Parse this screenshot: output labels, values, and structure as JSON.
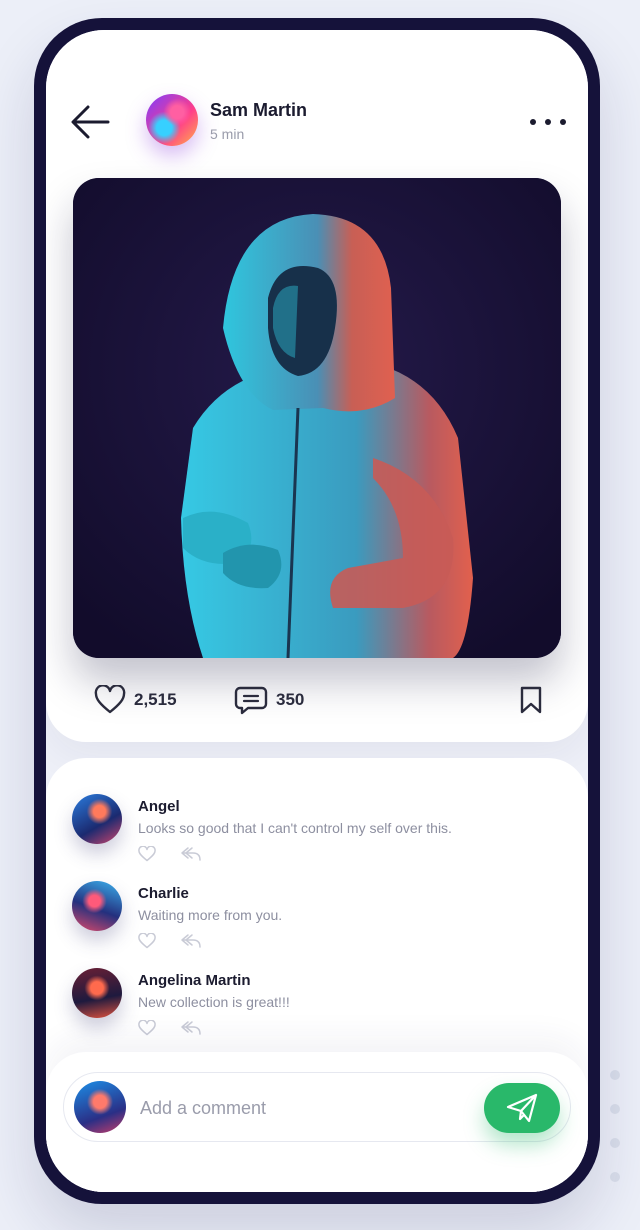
{
  "post": {
    "author": "Sam Martin",
    "time": "5 min",
    "likes": "2,515",
    "comments_count": "350"
  },
  "comments": [
    {
      "name": "Angel",
      "text": "Looks so good that I can't control my self over this."
    },
    {
      "name": "Charlie",
      "text": "Waiting more from you."
    },
    {
      "name": "Angelina Martin",
      "text": "New collection is great!!!"
    }
  ],
  "composer": {
    "placeholder": "Add a comment"
  },
  "colors": {
    "frame": "#15123a",
    "send_button": "#29b86a",
    "text_primary": "#1b1b2f",
    "text_secondary": "#8d8fa0"
  },
  "icons": {
    "back": "arrow-left-icon",
    "more": "more-horizontal-icon",
    "like": "heart-icon",
    "comment": "chat-bubble-icon",
    "bookmark": "bookmark-icon",
    "reply": "reply-icon",
    "send": "paper-plane-icon"
  }
}
